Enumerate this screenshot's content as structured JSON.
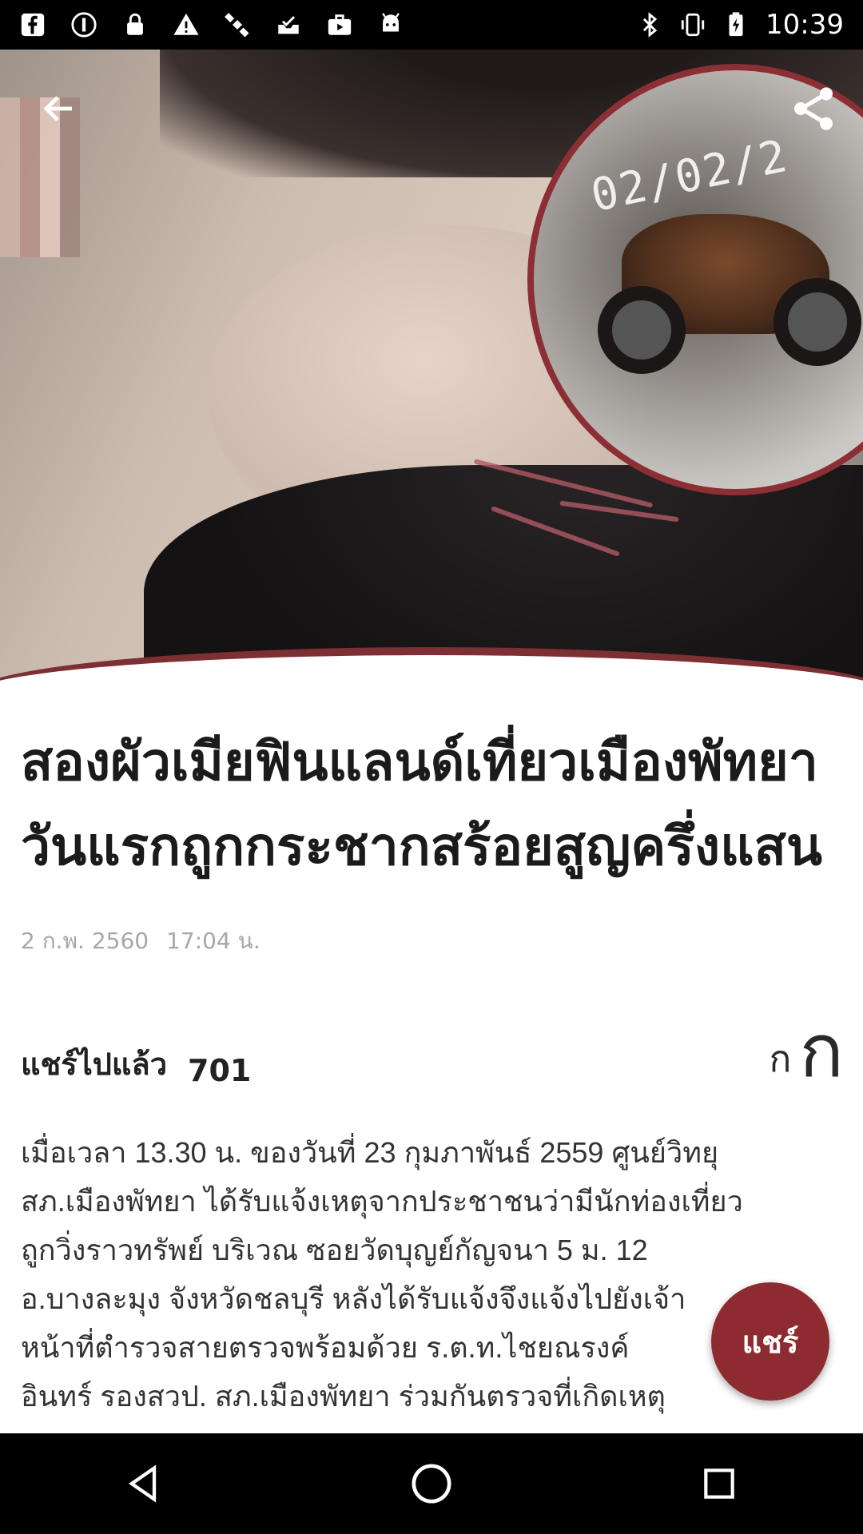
{
  "status_bar": {
    "time": "10:39",
    "left_icons": [
      "facebook-icon",
      "dnd-icon",
      "lock-icon",
      "warning-icon",
      "satellite-icon",
      "inbox-icon",
      "briefcase-icon",
      "android-icon"
    ],
    "right_icons": [
      "bluetooth-icon",
      "vibrate-icon",
      "battery-charging-icon"
    ]
  },
  "hero": {
    "inset_date_stamp": "02/02/2"
  },
  "article": {
    "headline_line1": "สองผัวเมียฟินแลนด์เที่ยวเมืองพัทยา",
    "headline_line2": "วันแรกถูกกระชากสร้อยสูญครึ่งแสน",
    "date": "2 ก.พ. 2560",
    "time": "17:04 น.",
    "shared_label": "แชร์ไปแล้ว",
    "shared_count": "701",
    "font_small_label": "ก",
    "font_large_label": "ก",
    "body_lines": [
      "เมื่อเวลา 13.30 น. ของวันที่ 23 กุมภาพันธ์ 2559  ศูนย์วิทยุ",
      "สภ.เมืองพัทยา ได้รับแจ้งเหตุจากประชาชนว่ามีนักท่องเที่ยว",
      "ถูกวิ่งราวทรัพย์ บริเวณ ซอยวัดบุญย์กัญจนา 5 ม. 12",
      "อ.บางละมุง จังหวัดชลบุรี  หลังได้รับแจ้งจึงแจ้งไปยังเจ้า",
      "หน้าที่ตำรวจสายตรวจพร้อมด้วย  ร.ต.ท.ไชยณรงค์",
      "อินทร์ รองสวป. สภ.เมืองพัทยา ร่วมกันตรวจที่เกิดเหตุ"
    ]
  },
  "fab": {
    "label": "แชร์"
  },
  "colors": {
    "accent": "#8e2b30",
    "headline": "#1b1b1b",
    "meta": "#a7a7a7"
  }
}
